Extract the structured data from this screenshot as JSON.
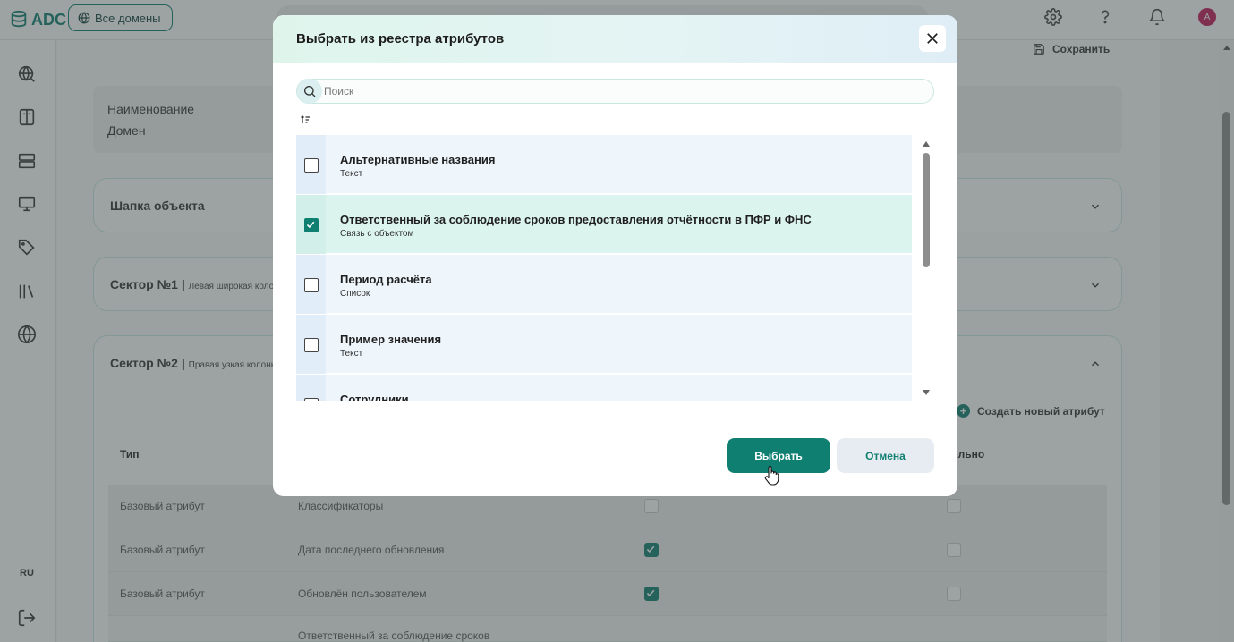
{
  "app": {
    "logo_text": "ADC",
    "all_domains_label": "Все домены",
    "language": "RU"
  },
  "page": {
    "save_label": "Сохранить",
    "name_label": "Наименование",
    "name_value": "Домен",
    "create_attribute_label": "Создать новый атрибут",
    "sections": [
      {
        "title": "Шапка объекта",
        "subtitle": ""
      },
      {
        "title": "Сектор №1",
        "subtitle": "Левая широкая колонка"
      },
      {
        "title": "Сектор №2",
        "subtitle": "Правая узкая колонка"
      }
    ],
    "table": {
      "col_type": "Тип",
      "col_required_partial": "ельно",
      "rows": [
        {
          "type": "Базовый атрибут",
          "name": "Классификаторы",
          "check1": false,
          "check2": false
        },
        {
          "type": "Базовый атрибут",
          "name": "Дата последнего обновления",
          "check1": true,
          "check2": false
        },
        {
          "type": "Базовый атрибут",
          "name": "Обновлён пользователем",
          "check1": true,
          "check2": false
        },
        {
          "type": "",
          "name": "Ответственный за соблюдение сроков",
          "check1": false,
          "check2": false
        }
      ]
    }
  },
  "modal": {
    "title": "Выбрать из реестра атрибутов",
    "search_placeholder": "Поиск",
    "items": [
      {
        "name": "Альтернативные названия",
        "type": "Текст",
        "checked": false
      },
      {
        "name": "Ответственный за соблюдение сроков предоставления отчётности в ПФР и ФНС",
        "type": "Связь с объектом",
        "checked": true
      },
      {
        "name": "Период расчёта",
        "type": "Список",
        "checked": false
      },
      {
        "name": "Пример значения",
        "type": "Текст",
        "checked": false
      },
      {
        "name": "Сотрудники",
        "type": "",
        "checked": false
      }
    ],
    "select_label": "Выбрать",
    "cancel_label": "Отмена"
  },
  "colors": {
    "accent": "#0f7f72",
    "selected_row": "#dcf4ee",
    "row": "#eef5fb"
  }
}
